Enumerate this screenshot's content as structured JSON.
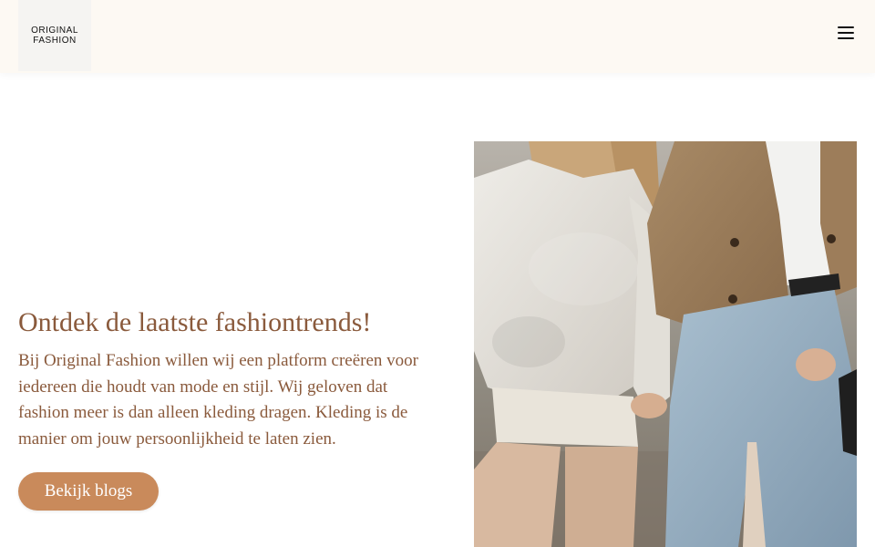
{
  "header": {
    "logo_line1": "ORIGINAL",
    "logo_line2": "FASHION",
    "menu_icon": "hamburger-menu-icon"
  },
  "hero": {
    "title": "Ontdek de laatste fashiontrends!",
    "text": "Bij Original Fashion willen wij een platform creëren voor iedereen die houdt van mode en stijl. Wij geloven dat fashion meer is dan alleen kleding dragen. Kleding is de manier om jouw persoonlijkheid te laten zien.",
    "button_label": "Bekijk blogs"
  },
  "colors": {
    "header_bg": "#fdf9f3",
    "text_brown": "#8a5a3c",
    "button_bg": "#c98a5b",
    "button_text": "#ffffff"
  }
}
